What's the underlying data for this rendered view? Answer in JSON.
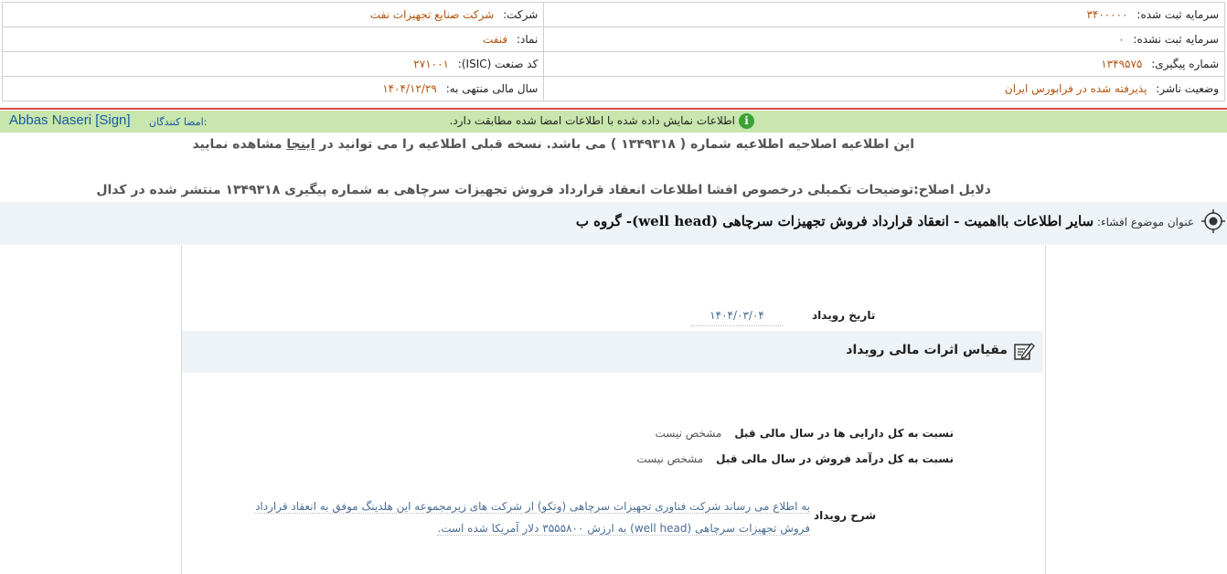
{
  "company_info": {
    "company_label": "شرکت:",
    "company_value": "شرکت صنایع تجهیزات نفت",
    "symbol_label": "نماد:",
    "symbol_value": "فنفت",
    "isic_label": "کد صنعت (ISIC):",
    "isic_value": "۲۷۱۰۰۱",
    "fiscal_label": "سال مالی منتهی به:",
    "fiscal_value": "۱۴۰۴/۱۲/۲۹",
    "reg_capital_label": "سرمایه ثبت شده:",
    "reg_capital_value": "۳۴۰۰۰۰۰",
    "unreg_capital_label": "سرمایه ثبت نشده:",
    "unreg_capital_value": "۰",
    "tracking_label": "شماره پیگیری:",
    "tracking_value": "۱۳۴۹۵۷۵",
    "publisher_label": "وضعیت ناشر:",
    "publisher_value": "پذیرفته شده در فرابورس ایران"
  },
  "signature": {
    "info_text": "اطلاعات نمایش داده شده با اطلاعات امضا شده مطابقت دارد.",
    "info_icon": "i",
    "signers_label": "امضا کنندگان:",
    "signer_name": "Abbas Naseri [Sign]"
  },
  "notice": {
    "text_before": "این اطلاعیه اصلاحیه اطلاعیه شماره ( ۱۳۴۹۳۱۸ ) می باشد. نسخه قبلی اطلاعیه را می توانید در",
    "link_text": "اینجا",
    "text_after": "مشاهده نمایید"
  },
  "correction_reasons": "دلایل اصلاح:توضیحات تکمیلی درخصوص افشا اطلاعات انعقاد قرارداد فروش تجهیزات سرچاهی به شماره پیگیری ۱۳۴۹۳۱۸ منتشر شده در کدال",
  "subject": {
    "label": "عنوان موضوع افشاء:",
    "value": "سایر اطلاعات بااهمیت - انعقاد قرارداد فروش تجهیزات سرچاهی (well head)- گروه ب"
  },
  "event": {
    "date_label": "تاریخ رویداد",
    "date_value": "۱۴۰۴/۰۳/۰۴",
    "financial_title": "مقیاس اثرات مالی رویداد",
    "ratio_assets_label": "نسبت به کل دارایی ها در سال مالی قبل",
    "ratio_assets_value": "مشخص نیست",
    "ratio_sales_label": "نسبت به کل درآمد فروش در سال مالی قبل",
    "ratio_sales_value": "مشخص نیست",
    "description_label": "شرح رویداد",
    "description_value": "به اطلاع می رساند شرکت فناوری تجهیزات سرچاهی (وتکو) از شرکت های زیرمجموعه این هلدینگ موفق به انعقاد قرارداد فروش تجهیزات سرچاهی (well head) به ارزش ۳۵۵۵۸۰۰ دلار آمریکا شده است."
  },
  "icons": {
    "info": "info-icon",
    "target": "target-icon",
    "pencil": "pencil-icon"
  },
  "colors": {
    "value_orange": "#b5530e",
    "sign_bar_green": "#c8e6ad",
    "link_blue": "#1a5aa0",
    "divider_red": "#e04848"
  }
}
